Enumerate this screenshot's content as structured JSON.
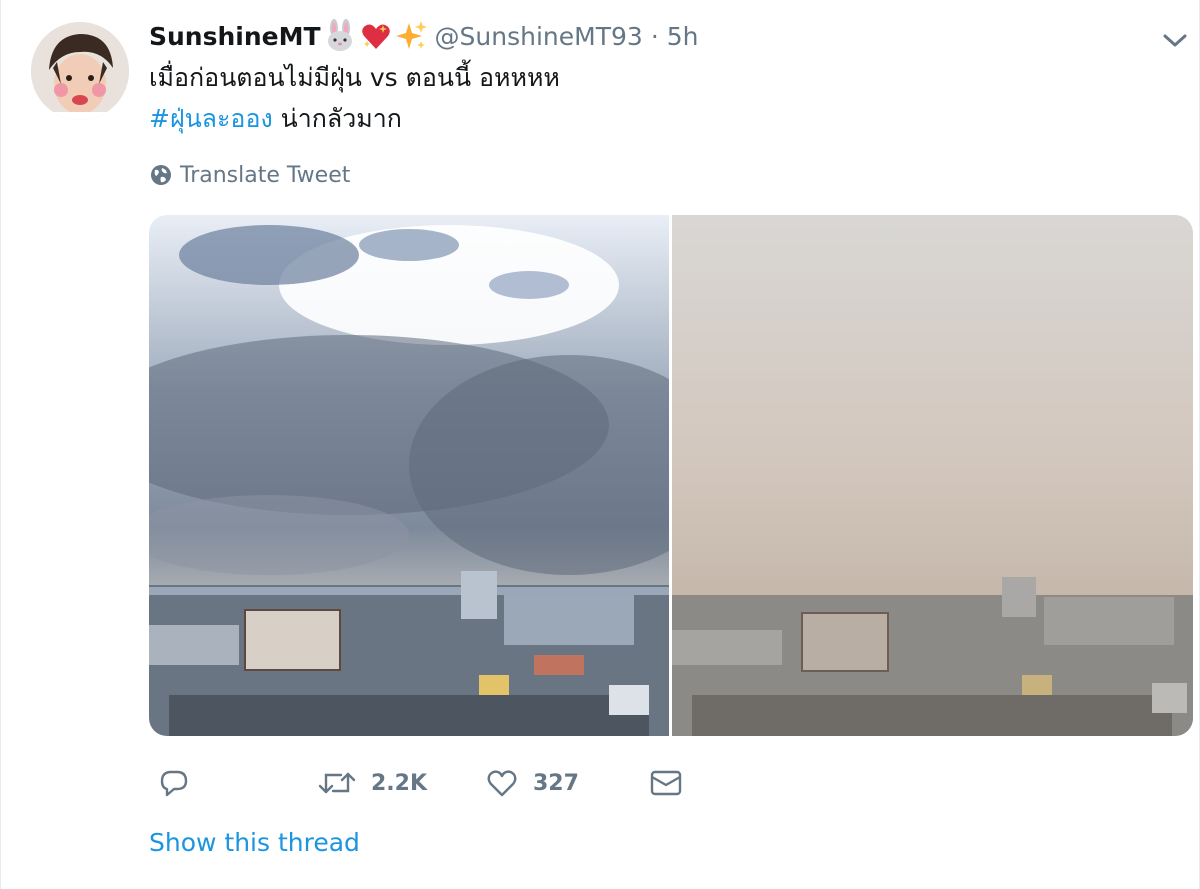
{
  "user": {
    "display_name": "SunshineMT",
    "handle": "@SunshineMT93",
    "separator": "·",
    "time": "5h",
    "emojis": [
      "rabbit-face-emoji",
      "sparkling-heart-emoji",
      "sparkles-emoji"
    ]
  },
  "tweet": {
    "line1": "เมื่อก่อนตอนไม่มีฝุ่น vs ตอนนี้ อหหหห",
    "hashtag": "#ฝุ่นละออง",
    "line2_rest": " น่ากลัวมาก"
  },
  "translate": {
    "label": "Translate Tweet",
    "icon": "globe-icon"
  },
  "media": {
    "photos": [
      {
        "name": "photo-before",
        "description_icon": "clear-sky-city"
      },
      {
        "name": "photo-after",
        "description_icon": "smoggy-sky-city"
      }
    ]
  },
  "actions": {
    "reply": {
      "icon": "reply-icon",
      "count": ""
    },
    "retweet": {
      "icon": "retweet-icon",
      "count": "2.2K"
    },
    "like": {
      "icon": "heart-icon",
      "count": "327"
    },
    "dm": {
      "icon": "envelope-icon",
      "count": ""
    }
  },
  "show_thread": "Show this thread",
  "colors": {
    "link": "#1b95e0",
    "secondary": "#657786",
    "primary_text": "#14171a"
  }
}
